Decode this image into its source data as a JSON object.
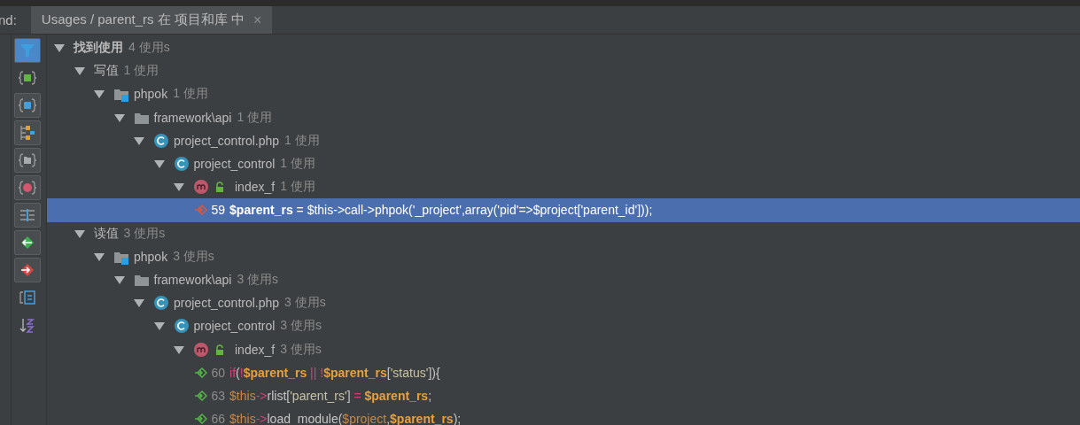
{
  "header": {
    "left_label": "nd:",
    "tabs": [
      {
        "label": "Usages / parent_rs 在 项目和库 中",
        "selected": true,
        "close": "×"
      }
    ]
  },
  "toolbar": {
    "buttons": [
      {
        "kind": "filter",
        "on": true
      },
      {
        "kind": "method-braces",
        "on": false
      },
      {
        "kind": "field-braces",
        "on": true
      },
      {
        "kind": "tree",
        "on": true
      },
      {
        "kind": "folder-braces",
        "on": true
      },
      {
        "kind": "method",
        "on": true
      },
      {
        "kind": "split",
        "on": true
      },
      {
        "kind": "read",
        "on": true
      },
      {
        "kind": "write",
        "on": true
      },
      {
        "kind": "preview",
        "on": false
      },
      {
        "kind": "sort",
        "on": false
      }
    ]
  },
  "tree": [
    {
      "label": "找到使用",
      "count": "4 使用s",
      "expanded": true,
      "bold": true,
      "children": [
        {
          "label": "写值",
          "count": "1 使用",
          "expanded": true,
          "children": [
            {
              "kind": "module",
              "label": "phpok",
              "count": "1 使用",
              "expanded": true,
              "children": [
                {
                  "kind": "folder",
                  "label": "framework\\api",
                  "count": "1 使用",
                  "expanded": true,
                  "children": [
                    {
                      "kind": "file",
                      "label": "project_control.php",
                      "count": "1 使用",
                      "expanded": true,
                      "children": [
                        {
                          "kind": "class",
                          "label": "project_control",
                          "count": "1 使用",
                          "expanded": true,
                          "children": [
                            {
                              "kind": "method",
                              "label": "index_f",
                              "count": "1 使用",
                              "expanded": true,
                              "children": [
                                {
                                  "kind": "write",
                                  "line": "59",
                                  "selected": true,
                                  "code": [
                                    {
                                      "kind": "var",
                                      "text": "$parent_rs"
                                    },
                                    {
                                      "kind": "plain",
                                      "text": " = "
                                    },
                                    {
                                      "kind": "var2",
                                      "text": "$this"
                                    },
                                    {
                                      "kind": "op",
                                      "text": "->"
                                    },
                                    {
                                      "kind": "plain",
                                      "text": "call"
                                    },
                                    {
                                      "kind": "op",
                                      "text": "->"
                                    },
                                    {
                                      "kind": "plain",
                                      "text": "phpok("
                                    },
                                    {
                                      "kind": "string",
                                      "text": "'_project'"
                                    },
                                    {
                                      "kind": "plain",
                                      "text": ",array("
                                    },
                                    {
                                      "kind": "string",
                                      "text": "'pid'"
                                    },
                                    {
                                      "kind": "op",
                                      "text": "=>"
                                    },
                                    {
                                      "kind": "var2",
                                      "text": "$project"
                                    },
                                    {
                                      "kind": "plain",
                                      "text": "["
                                    },
                                    {
                                      "kind": "string",
                                      "text": "'parent_id'"
                                    },
                                    {
                                      "kind": "plain",
                                      "text": "]));"
                                    }
                                  ]
                                }
                              ]
                            }
                          ]
                        }
                      ]
                    }
                  ]
                }
              ]
            }
          ]
        },
        {
          "label": "读值",
          "count": "3 使用s",
          "expanded": true,
          "children": [
            {
              "kind": "module",
              "label": "phpok",
              "count": "3 使用s",
              "expanded": true,
              "children": [
                {
                  "kind": "folder",
                  "label": "framework\\api",
                  "count": "3 使用s",
                  "expanded": true,
                  "children": [
                    {
                      "kind": "file",
                      "label": "project_control.php",
                      "count": "3 使用s",
                      "expanded": true,
                      "children": [
                        {
                          "kind": "class",
                          "label": "project_control",
                          "count": "3 使用s",
                          "expanded": true,
                          "children": [
                            {
                              "kind": "method",
                              "label": "index_f",
                              "count": "3 使用s",
                              "expanded": true,
                              "children": [
                                {
                                  "kind": "read",
                                  "line": "60",
                                  "selected": false,
                                  "code": [
                                    {
                                      "kind": "keyword",
                                      "text": "if"
                                    },
                                    {
                                      "kind": "plain",
                                      "text": "("
                                    },
                                    {
                                      "kind": "op",
                                      "text": "!"
                                    },
                                    {
                                      "kind": "var",
                                      "text": "$parent_rs"
                                    },
                                    {
                                      "kind": "op",
                                      "text": " || !"
                                    },
                                    {
                                      "kind": "var",
                                      "text": "$parent_rs"
                                    },
                                    {
                                      "kind": "plain",
                                      "text": "["
                                    },
                                    {
                                      "kind": "string",
                                      "text": "'status'"
                                    },
                                    {
                                      "kind": "plain",
                                      "text": "]){"
                                    }
                                  ]
                                },
                                {
                                  "kind": "read",
                                  "line": "63",
                                  "selected": false,
                                  "code": [
                                    {
                                      "kind": "var2",
                                      "text": "$this"
                                    },
                                    {
                                      "kind": "op",
                                      "text": "->"
                                    },
                                    {
                                      "kind": "plain",
                                      "text": "rlist["
                                    },
                                    {
                                      "kind": "string",
                                      "text": "'parent_rs'"
                                    },
                                    {
                                      "kind": "plain",
                                      "text": "] "
                                    },
                                    {
                                      "kind": "op",
                                      "text": "= "
                                    },
                                    {
                                      "kind": "var",
                                      "text": "$parent_rs"
                                    },
                                    {
                                      "kind": "plain",
                                      "text": ";"
                                    }
                                  ]
                                },
                                {
                                  "kind": "read",
                                  "line": "66",
                                  "selected": false,
                                  "code": [
                                    {
                                      "kind": "var2",
                                      "text": "$this"
                                    },
                                    {
                                      "kind": "op",
                                      "text": "->"
                                    },
                                    {
                                      "kind": "plain",
                                      "text": "load_module("
                                    },
                                    {
                                      "kind": "var2",
                                      "text": "$project"
                                    },
                                    {
                                      "kind": "plain",
                                      "text": ","
                                    },
                                    {
                                      "kind": "var",
                                      "text": "$parent_rs"
                                    },
                                    {
                                      "kind": "plain",
                                      "text": ");"
                                    }
                                  ]
                                }
                              ]
                            }
                          ]
                        }
                      ]
                    }
                  ]
                }
              ]
            }
          ]
        }
      ]
    }
  ]
}
